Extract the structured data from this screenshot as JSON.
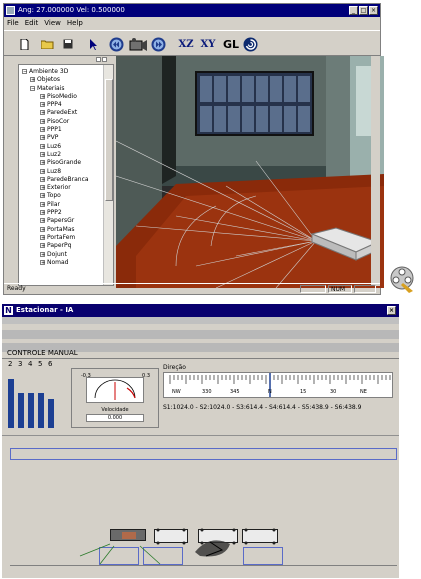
{
  "win1": {
    "title": "Ang: 27.000000 Vel: 0.500000",
    "menu": [
      "File",
      "Edit",
      "View",
      "Help"
    ],
    "toolbar": {
      "xz": "XZ",
      "xy": "XY",
      "gl": "GL"
    },
    "tree": {
      "root": "Ambiente 3D",
      "objetos": "Objetos",
      "materiais": "Materiais",
      "items": [
        "PisoMedio",
        "PPP4",
        "ParedeExt",
        "PisoCor",
        "PPP1",
        "PVP",
        "Luz6",
        "Luz2",
        "PisoGrande",
        "Luz8",
        "ParedeBranca",
        "Exterior",
        "Topo",
        "Pilar",
        "PPP2",
        "PapersGr",
        "PortaMas",
        "PortaFem",
        "PaperPq",
        "Dojunt",
        "Nomad"
      ]
    },
    "status": {
      "left": "Ready",
      "num": "NUM"
    }
  },
  "win2": {
    "title": "Estacionar - IA",
    "section": "CONTROLE MANUAL",
    "gear_numbers": [
      "2",
      "3",
      "4",
      "5",
      "6"
    ],
    "gear_values": [
      0.85,
      0.6,
      0.6,
      0.6,
      0.5
    ],
    "speed": {
      "min": "-0.3",
      "max": "0.3",
      "label": "Velocidade",
      "value": "0.000"
    },
    "direction": {
      "label": "Direção",
      "ticks": [
        "NW",
        "330",
        "345",
        "N",
        "15",
        "30",
        "NE"
      ],
      "readout": "S1:1024.0 - S2:1024.0 - S3:614.4 - S4:614.4 - S5:438.9 - S6:438.9"
    }
  },
  "colors": {
    "titlebar": "#00007a",
    "bars": "#1c3f93",
    "floor": "#8a2a0a"
  }
}
